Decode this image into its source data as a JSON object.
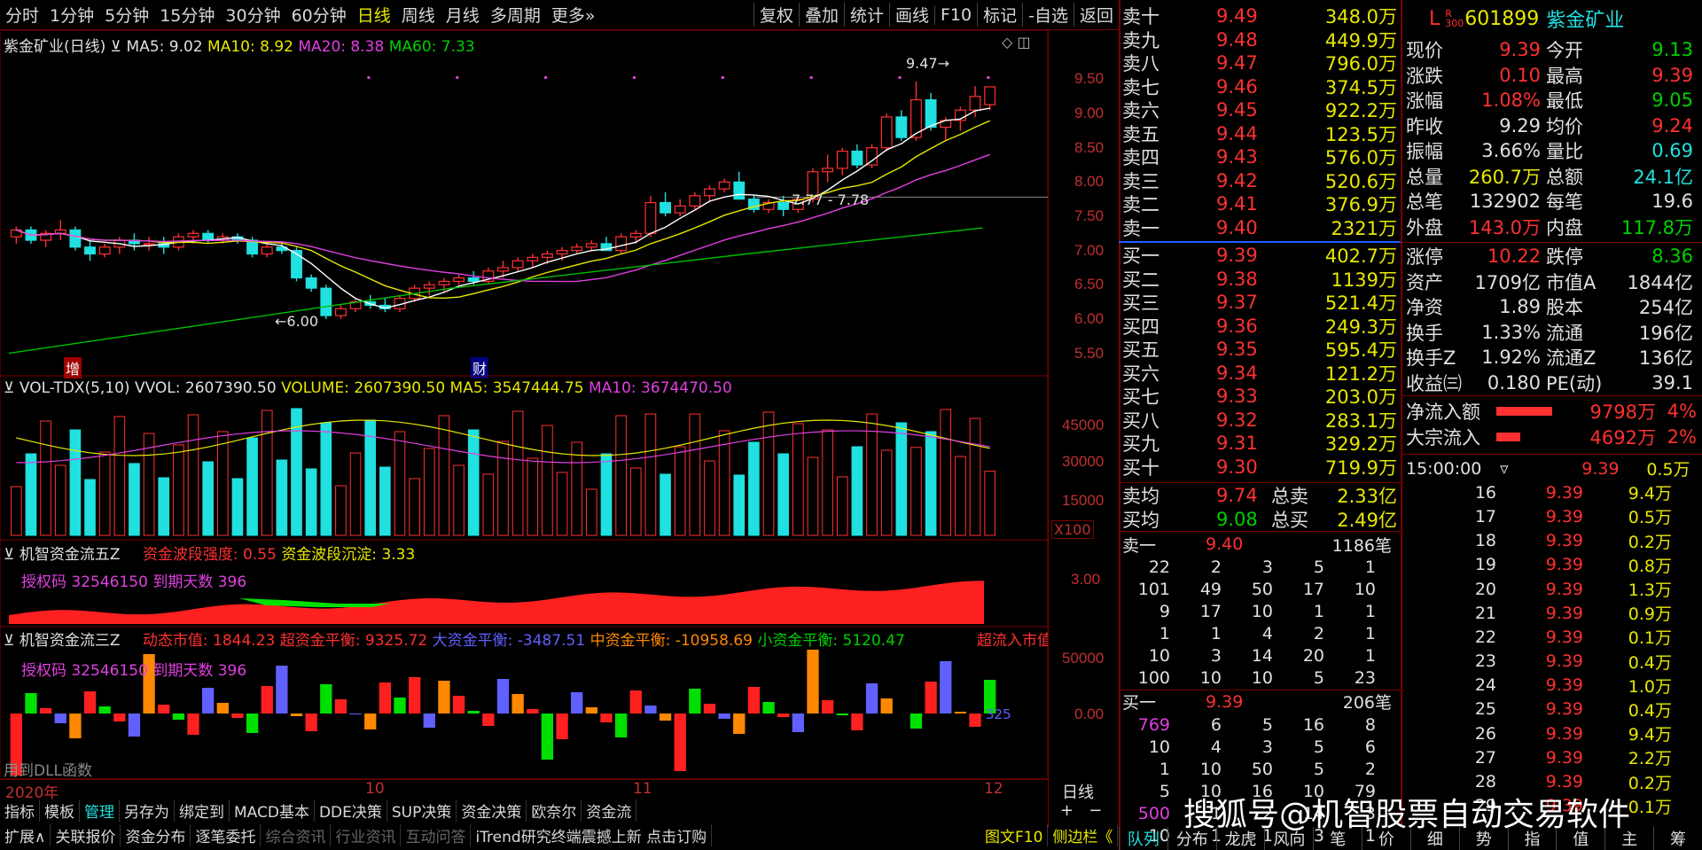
{
  "toolbar": {
    "periods": [
      "分时",
      "1分钟",
      "5分钟",
      "15分钟",
      "30分钟",
      "60分钟",
      "日线",
      "周线",
      "月线",
      "多周期",
      "更多»"
    ],
    "tools": [
      "复权",
      "叠加",
      "统计",
      "画线",
      "F10",
      "标记",
      "-自选",
      "返回"
    ]
  },
  "kline": {
    "title": "紫金矿业(日线)",
    "ma5": "MA5: 9.02",
    "ma10": "MA10: 8.92",
    "ma20": "MA20: 8.38",
    "ma60": "MA60: 7.33",
    "hi_label": "9.47→",
    "range_label": "7.77 - 7.78",
    "low_label": "←6.00",
    "mark_zeng": "增",
    "mark_cai": "财",
    "yaxis": [
      "9.50",
      "9.00",
      "8.50",
      "8.00",
      "7.50",
      "7.00",
      "6.50",
      "6.00",
      "5.50"
    ]
  },
  "vol": {
    "title": "VOL-TDX(5,10) VVOL: 2607390.50",
    "volume": "VOLUME: 2607390.50",
    "ma5": "MA5: 3547444.75",
    "ma10": "MA10: 3674470.50",
    "yaxis": [
      "45000",
      "30000",
      "15000"
    ],
    "unit": "X100"
  },
  "flow5": {
    "title": "机智资金流五Z",
    "strength": "资金波段强度: 0.55",
    "settle": "资金波段沉淀: 3.33",
    "auth": "授权码 32546150 到期天数 396",
    "yaxis": "3.00"
  },
  "flow3": {
    "title": "机智资金流三Z",
    "dyn": "动态市值: 1844.23",
    "super": "超资金平衡: 9325.72",
    "big": "大资金平衡: -3487.51",
    "mid": "中资金平衡: -10958.69",
    "small": "小资金平衡: 5120.47",
    "inflow": "超流入市值",
    "auth": "授权码 32546150 到期天数 396",
    "dll": "用到DLL函数",
    "yaxis": [
      "50000",
      "0.00"
    ],
    "right_val": "325"
  },
  "xaxis": {
    "y2020": "2020年",
    "m10": "10",
    "m11": "11",
    "m12": "12",
    "period": "日线"
  },
  "bottom1": [
    "指标",
    "模板",
    "管理",
    "另存为",
    "绑定到",
    "MACD基本",
    "DDE决策",
    "SUP决策",
    "资金决策",
    "欧奈尔",
    "资金流"
  ],
  "bottom2": [
    "扩展∧",
    "关联报价",
    "资金分布",
    "逐笔委托",
    "综合资讯",
    "行业资讯",
    "互动问答",
    "iTrend研究终端震撼上新 点击订购"
  ],
  "bottom2_right": [
    "图文F10",
    "侧边栏《"
  ],
  "sell": [
    [
      "卖十",
      "9.49",
      "348.0万"
    ],
    [
      "卖九",
      "9.48",
      "449.9万"
    ],
    [
      "卖八",
      "9.47",
      "796.0万"
    ],
    [
      "卖七",
      "9.46",
      "374.5万"
    ],
    [
      "卖六",
      "9.45",
      "922.2万"
    ],
    [
      "卖五",
      "9.44",
      "123.5万"
    ],
    [
      "卖四",
      "9.43",
      "576.0万"
    ],
    [
      "卖三",
      "9.42",
      "520.6万"
    ],
    [
      "卖二",
      "9.41",
      "376.9万"
    ],
    [
      "卖一",
      "9.40",
      "2321万"
    ]
  ],
  "buy": [
    [
      "买一",
      "9.39",
      "402.7万"
    ],
    [
      "买二",
      "9.38",
      "1139万"
    ],
    [
      "买三",
      "9.37",
      "521.4万"
    ],
    [
      "买四",
      "9.36",
      "249.3万"
    ],
    [
      "买五",
      "9.35",
      "595.4万"
    ],
    [
      "买六",
      "9.34",
      "121.2万"
    ],
    [
      "买七",
      "9.33",
      "203.0万"
    ],
    [
      "买八",
      "9.32",
      "283.1万"
    ],
    [
      "买九",
      "9.31",
      "329.2万"
    ],
    [
      "买十",
      "9.30",
      "719.9万"
    ]
  ],
  "avg": {
    "sell_label": "卖均",
    "sell_val": "9.74",
    "sell_total_label": "总卖",
    "sell_total": "2.33亿",
    "buy_label": "买均",
    "buy_val": "9.08",
    "buy_total_label": "总买",
    "buy_total": "2.49亿"
  },
  "queue": {
    "sell1_label": "卖一",
    "sell1_price": "9.40",
    "sell1_count": "1186笔",
    "sell_rows": [
      [
        "22",
        "2",
        "3",
        "5",
        "1"
      ],
      [
        "101",
        "49",
        "50",
        "17",
        "10"
      ],
      [
        "9",
        "17",
        "10",
        "1",
        "1"
      ],
      [
        "1",
        "1",
        "4",
        "2",
        "1"
      ],
      [
        "10",
        "3",
        "14",
        "20",
        "1"
      ],
      [
        "100",
        "10",
        "10",
        "5",
        "23"
      ]
    ],
    "buy1_label": "买一",
    "buy1_price": "9.39",
    "buy1_count": "206笔",
    "buy_rows": [
      [
        "769",
        "6",
        "5",
        "16",
        "8"
      ],
      [
        "10",
        "4",
        "3",
        "5",
        "6"
      ],
      [
        "1",
        "10",
        "50",
        "5",
        "2"
      ],
      [
        "5",
        "10",
        "16",
        "10",
        "79"
      ],
      [
        "500",
        "1",
        "2",
        "14",
        "3"
      ],
      [
        "10",
        "1",
        "1",
        "3",
        "1"
      ]
    ]
  },
  "stock": {
    "flag": "L",
    "flag2": "R 300",
    "code": "601899",
    "name": "紫金矿业"
  },
  "quote": [
    [
      "现价",
      "9.39",
      "今开",
      "9.13"
    ],
    [
      "涨跌",
      "0.10",
      "最高",
      "9.39"
    ],
    [
      "涨幅",
      "1.08%",
      "最低",
      "9.05"
    ],
    [
      "昨收",
      "9.29",
      "均价",
      "9.24"
    ],
    [
      "振幅",
      "3.66%",
      "量比",
      "0.69"
    ],
    [
      "总量",
      "260.7万",
      "总额",
      "24.1亿"
    ],
    [
      "总笔",
      "132902",
      "每笔",
      "19.6"
    ],
    [
      "外盘",
      "143.0万",
      "内盘",
      "117.8万"
    ]
  ],
  "fund": [
    [
      "涨停",
      "10.22",
      "跌停",
      "8.36"
    ],
    [
      "资产",
      "1709亿",
      "市值A",
      "1844亿"
    ],
    [
      "净资",
      "1.89",
      "股本",
      "254亿"
    ],
    [
      "换手",
      "1.33%",
      "流通",
      "196亿"
    ],
    [
      "换手Z",
      "1.92%",
      "流通Z",
      "136亿"
    ],
    [
      "收益㈢",
      "0.180",
      "PE(动)",
      "39.1"
    ]
  ],
  "netflow": {
    "label1": "净流入额",
    "val1": "9798万",
    "pct1": "4%",
    "label2": "大宗流入",
    "val2": "4692万",
    "pct2": "2%",
    "bar1_frac": 0.7,
    "bar2_frac": 0.3
  },
  "ticks": {
    "time": "15:00:00",
    "rows": [
      [
        "",
        "9.39",
        "0.5万"
      ],
      [
        "16",
        "9.39",
        "9.4万"
      ],
      [
        "17",
        "9.39",
        "0.5万"
      ],
      [
        "18",
        "9.39",
        "0.2万"
      ],
      [
        "19",
        "9.39",
        "0.8万"
      ],
      [
        "20",
        "9.39",
        "1.3万"
      ],
      [
        "21",
        "9.39",
        "0.9万"
      ],
      [
        "22",
        "9.39",
        "0.1万"
      ],
      [
        "23",
        "9.39",
        "0.4万"
      ],
      [
        "24",
        "9.39",
        "1.0万"
      ],
      [
        "25",
        "9.39",
        "0.4万"
      ],
      [
        "26",
        "9.39",
        "9.4万"
      ],
      [
        "27",
        "9.39",
        "2.2万"
      ],
      [
        "28",
        "9.39",
        "0.2万"
      ],
      [
        "29",
        "9.39",
        "0.1万"
      ]
    ]
  },
  "tabs": [
    "队列",
    "分布",
    "龙虎",
    "风向",
    "笔",
    "价",
    "细",
    "势",
    "指",
    "值",
    "主",
    "筹"
  ],
  "watermark": "搜狐号@机智股票自动交易软件",
  "colors": {
    "up": "#ff3030",
    "down": "#20e0e0",
    "ma5": "#ffffff",
    "ma10": "#e8e800",
    "ma20": "#e040e0",
    "ma60": "#00c000"
  },
  "chart_data": {
    "type": "candlestick",
    "title": "紫金矿业(日线)",
    "ohlc": [
      [
        7.2,
        7.35,
        7.1,
        7.3
      ],
      [
        7.3,
        7.35,
        7.1,
        7.15
      ],
      [
        7.15,
        7.3,
        7.05,
        7.25
      ],
      [
        7.25,
        7.45,
        7.15,
        7.3
      ],
      [
        7.3,
        7.35,
        7.0,
        7.05
      ],
      [
        7.05,
        7.15,
        6.85,
        6.95
      ],
      [
        6.95,
        7.1,
        6.9,
        7.05
      ],
      [
        7.05,
        7.2,
        6.95,
        7.15
      ],
      [
        7.15,
        7.25,
        7.0,
        7.1
      ],
      [
        7.1,
        7.2,
        7.0,
        7.1
      ],
      [
        7.1,
        7.2,
        6.95,
        7.05
      ],
      [
        7.05,
        7.25,
        7.0,
        7.2
      ],
      [
        7.2,
        7.3,
        7.1,
        7.25
      ],
      [
        7.25,
        7.3,
        7.1,
        7.15
      ],
      [
        7.15,
        7.25,
        7.1,
        7.2
      ],
      [
        7.2,
        7.25,
        7.1,
        7.15
      ],
      [
        7.15,
        7.2,
        6.9,
        6.95
      ],
      [
        6.95,
        7.1,
        6.9,
        7.05
      ],
      [
        7.05,
        7.1,
        6.95,
        7.0
      ],
      [
        7.0,
        7.05,
        6.55,
        6.6
      ],
      [
        6.6,
        6.65,
        6.4,
        6.45
      ],
      [
        6.45,
        6.5,
        6.0,
        6.05
      ],
      [
        6.05,
        6.2,
        6.0,
        6.15
      ],
      [
        6.15,
        6.3,
        6.1,
        6.25
      ],
      [
        6.25,
        6.35,
        6.15,
        6.2
      ],
      [
        6.2,
        6.3,
        6.1,
        6.15
      ],
      [
        6.15,
        6.35,
        6.1,
        6.3
      ],
      [
        6.3,
        6.5,
        6.25,
        6.45
      ],
      [
        6.45,
        6.55,
        6.35,
        6.5
      ],
      [
        6.5,
        6.6,
        6.4,
        6.55
      ],
      [
        6.55,
        6.65,
        6.5,
        6.6
      ],
      [
        6.6,
        6.7,
        6.5,
        6.55
      ],
      [
        6.55,
        6.75,
        6.5,
        6.7
      ],
      [
        6.7,
        6.85,
        6.6,
        6.75
      ],
      [
        6.75,
        6.9,
        6.7,
        6.85
      ],
      [
        6.85,
        6.95,
        6.75,
        6.9
      ],
      [
        6.9,
        7.0,
        6.8,
        6.95
      ],
      [
        6.95,
        7.05,
        6.85,
        7.0
      ],
      [
        7.0,
        7.1,
        6.95,
        7.05
      ],
      [
        7.05,
        7.15,
        7.0,
        7.1
      ],
      [
        7.1,
        7.2,
        7.0,
        7.0
      ],
      [
        7.0,
        7.25,
        6.95,
        7.2
      ],
      [
        7.2,
        7.3,
        7.1,
        7.25
      ],
      [
        7.25,
        7.8,
        7.2,
        7.7
      ],
      [
        7.7,
        7.85,
        7.5,
        7.55
      ],
      [
        7.55,
        7.75,
        7.5,
        7.65
      ],
      [
        7.65,
        7.85,
        7.6,
        7.8
      ],
      [
        7.8,
        7.95,
        7.7,
        7.9
      ],
      [
        7.9,
        8.05,
        7.85,
        8.0
      ],
      [
        8.0,
        8.15,
        7.9,
        7.75
      ],
      [
        7.75,
        7.8,
        7.55,
        7.6
      ],
      [
        7.6,
        7.75,
        7.55,
        7.7
      ],
      [
        7.7,
        7.8,
        7.5,
        7.6
      ],
      [
        7.6,
        7.8,
        7.55,
        7.75
      ],
      [
        7.75,
        8.2,
        7.7,
        8.15
      ],
      [
        8.15,
        8.4,
        8.0,
        8.2
      ],
      [
        8.2,
        8.5,
        8.1,
        8.45
      ],
      [
        8.45,
        8.55,
        8.2,
        8.25
      ],
      [
        8.25,
        8.55,
        8.2,
        8.5
      ],
      [
        8.5,
        9.0,
        8.45,
        8.95
      ],
      [
        8.95,
        9.05,
        8.6,
        8.65
      ],
      [
        8.65,
        9.47,
        8.6,
        9.2
      ],
      [
        9.2,
        9.3,
        8.75,
        8.8
      ],
      [
        8.8,
        8.95,
        8.6,
        8.9
      ],
      [
        8.9,
        9.1,
        8.75,
        9.05
      ],
      [
        9.05,
        9.4,
        8.95,
        9.25
      ],
      [
        9.13,
        9.39,
        9.05,
        9.39
      ]
    ],
    "ylim": [
      5.3,
      9.7
    ]
  }
}
